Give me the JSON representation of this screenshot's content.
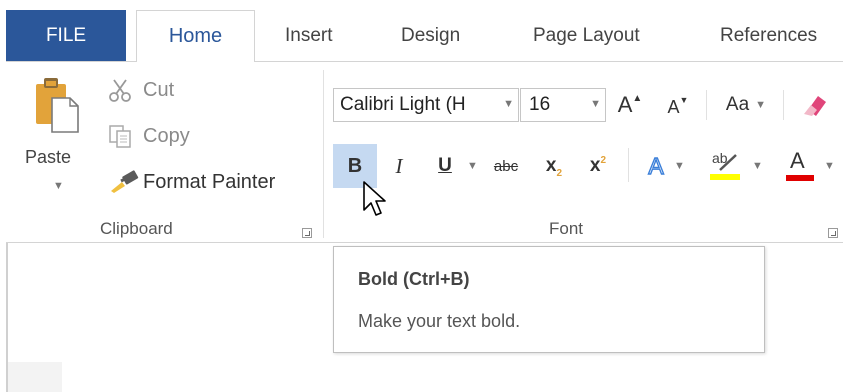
{
  "tabs": {
    "file": "FILE",
    "home": "Home",
    "insert": "Insert",
    "design": "Design",
    "page_layout": "Page Layout",
    "references": "References"
  },
  "clipboard": {
    "paste_label": "Paste",
    "cut_label": "Cut",
    "copy_label": "Copy",
    "format_painter_label": "Format Painter",
    "group_label": "Clipboard"
  },
  "font": {
    "font_name": "Calibri Light (H",
    "font_size": "16",
    "change_case_label": "Aa",
    "bold_glyph": "B",
    "italic_glyph": "I",
    "underline_glyph": "U",
    "strikethrough_glyph": "abc",
    "subscript_glyph": "x",
    "subscript_mark": "2",
    "superscript_glyph": "x",
    "superscript_mark": "2",
    "text_effects_glyph": "A",
    "highlight_glyph": "ab",
    "font_color_glyph": "A",
    "grow_glyph": "A",
    "shrink_glyph": "A",
    "group_label": "Font"
  },
  "tooltip": {
    "title": "Bold (Ctrl+B)",
    "description": "Make your text bold."
  },
  "colors": {
    "file_tab_bg": "#2b579a",
    "accent": "#2b579a",
    "bold_pressed_bg": "#c5d9f1",
    "highlight_yellow": "#ffff00",
    "font_color_red": "#e00000",
    "text_effects_blue": "#3b7fd9",
    "paste_orange": "#e2a33a"
  },
  "icons": {
    "paste": "paste-clipboard-icon",
    "cut": "scissors-icon",
    "copy": "copy-icon",
    "format_painter": "paintbrush-icon",
    "clear_formatting": "eraser-icon",
    "cursor": "mouse-pointer-icon",
    "launcher": "dialog-launcher-icon"
  }
}
